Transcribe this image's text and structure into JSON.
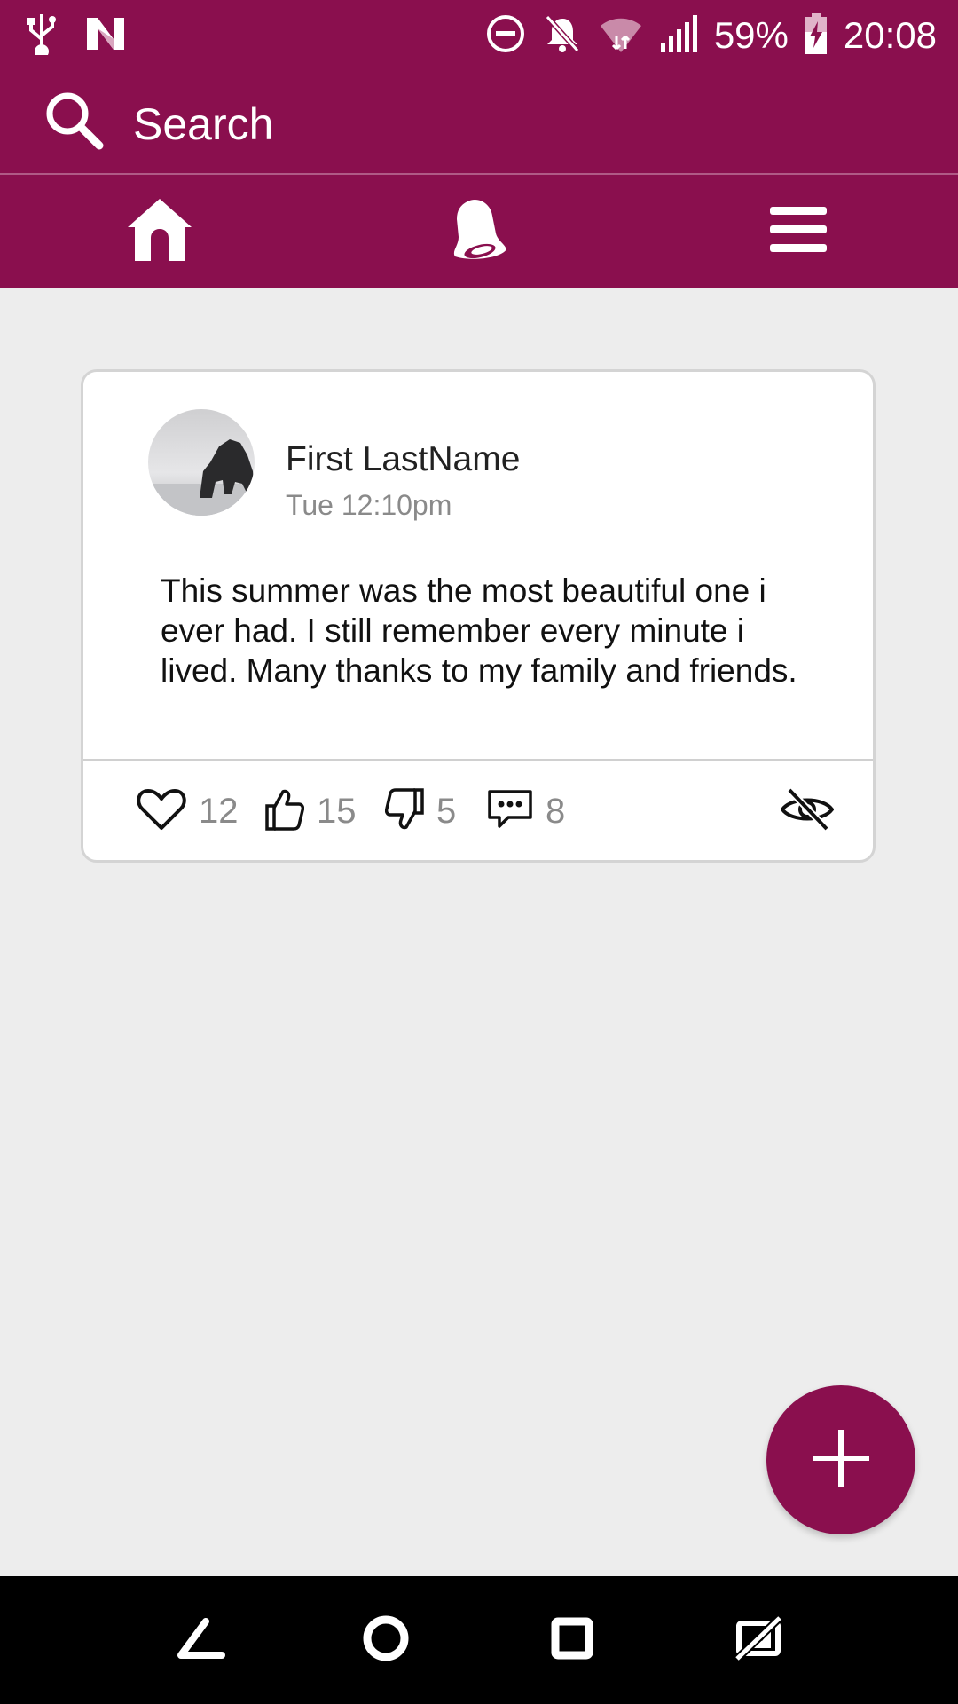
{
  "status_bar": {
    "battery": "59%",
    "time": "20:08",
    "icons": [
      "usb-icon",
      "n-icon",
      "do-not-disturb-icon",
      "notifications-off-icon",
      "wifi-icon",
      "signal-icon",
      "battery-charging-icon"
    ]
  },
  "search": {
    "label": "Search"
  },
  "nav": {
    "items": [
      {
        "name": "home",
        "icon": "home-icon"
      },
      {
        "name": "notifications",
        "icon": "bell-icon"
      },
      {
        "name": "menu",
        "icon": "hamburger-icon"
      }
    ]
  },
  "post": {
    "author": "First LastName",
    "time": "Tue 12:10pm",
    "body": "This summer was the most beautiful one i ever had. I still remember every minute i lived. Many thanks to my family and friends.",
    "counts": {
      "likes": "12",
      "thumbs_up": "15",
      "thumbs_down": "5",
      "comments": "8"
    }
  },
  "fab": {
    "icon": "plus-icon"
  },
  "colors": {
    "primary": "#8a0f4e",
    "background": "#ededed"
  }
}
